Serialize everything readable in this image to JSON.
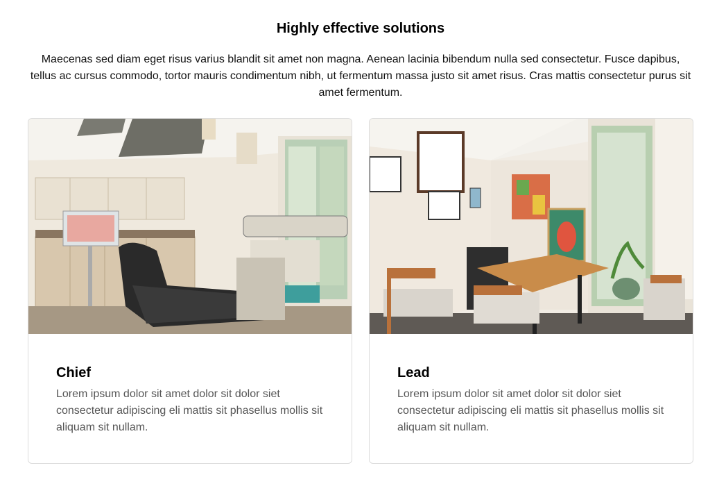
{
  "section": {
    "title": "Highly effective solutions",
    "intro": "Maecenas sed diam eget risus varius blandit sit amet non magna. Aenean lacinia bibendum nulla sed consectetur. Fusce dapibus, tellus ac cursus commodo, tortor mauris condimentum nibh, ut fermentum massa justo sit amet risus. Cras mattis consectetur purus sit amet fermentum."
  },
  "cards": [
    {
      "title": "Chief",
      "text": "Lorem ipsum dolor sit amet dolor sit dolor siet consectetur adipiscing eli mattis sit phasellus mollis sit aliquam sit nullam.",
      "image": "dental-operatory-photo"
    },
    {
      "title": "Lead",
      "text": "Lorem ipsum dolor sit amet dolor sit dolor siet consectetur adipiscing eli mattis sit phasellus mollis sit aliquam sit nullam.",
      "image": "office-dining-room-photo"
    }
  ]
}
